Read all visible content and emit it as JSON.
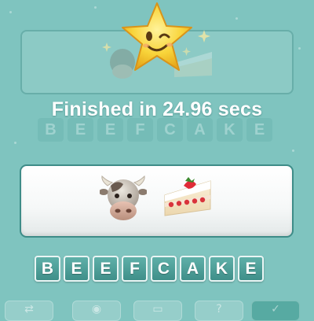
{
  "result": {
    "finished_text": "Finished in 24.96 secs"
  },
  "puzzle": {
    "emojis": [
      "cow-face",
      "strawberry-shortcake"
    ]
  },
  "answer": {
    "letters": [
      "B",
      "E",
      "E",
      "F",
      "C",
      "A",
      "K",
      "E"
    ]
  },
  "toolbar": {
    "icons": [
      "swap-icon",
      "eye-icon",
      "letter-icon",
      "help-icon",
      "check-icon"
    ]
  },
  "colors": {
    "background": "#7fc4bf",
    "tile": "#4a9e98",
    "card_border": "#3e8c88",
    "star": "#f7d23a"
  }
}
